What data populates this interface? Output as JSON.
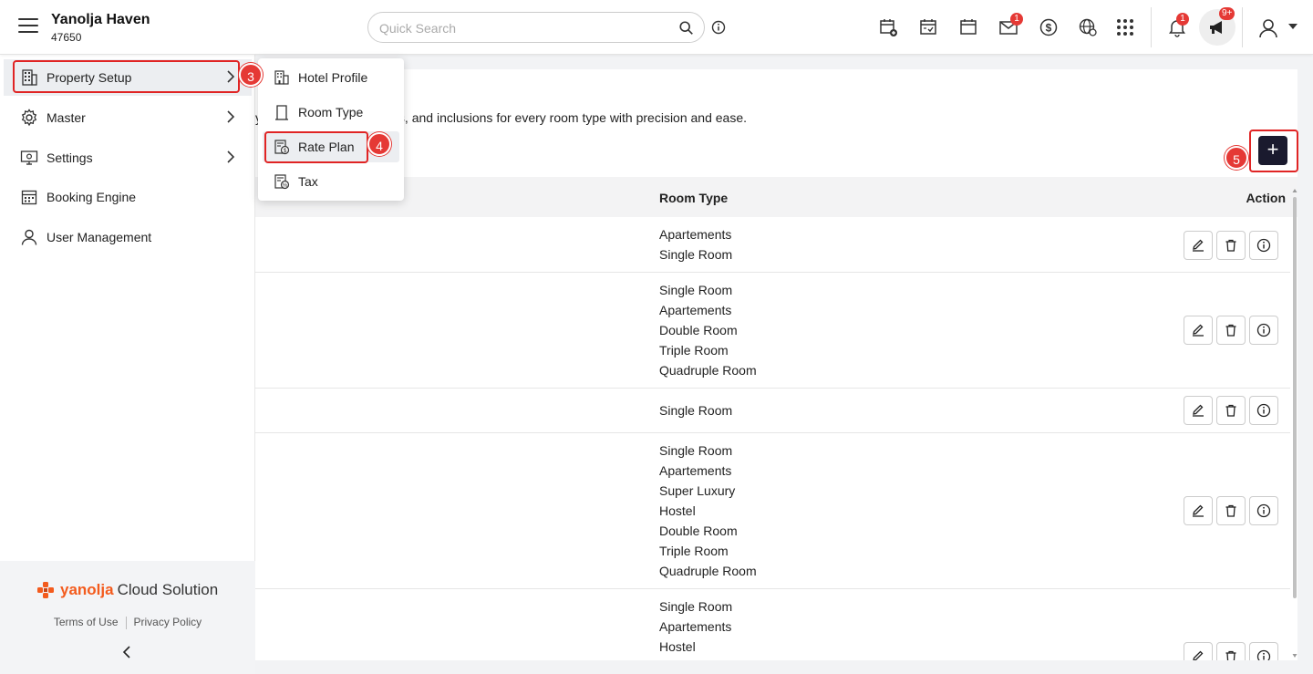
{
  "header": {
    "hotel_name": "Yanolja Haven",
    "hotel_id": "47650",
    "search_placeholder": "Quick Search",
    "mail_badge": "1",
    "notification_badge": "1",
    "announcement_badge": "9+"
  },
  "sidebar": {
    "items": [
      {
        "label": "Property Setup",
        "icon": "building-icon"
      },
      {
        "label": "Master",
        "icon": "gear-icon"
      },
      {
        "label": "Settings",
        "icon": "monitor-settings-icon"
      },
      {
        "label": "Booking Engine",
        "icon": "calendar-grid-icon"
      },
      {
        "label": "User Management",
        "icon": "user-icon"
      }
    ],
    "footer": {
      "brand_name": "yanolja",
      "brand_suffix": "Cloud Solution",
      "terms": "Terms of Use",
      "privacy": "Privacy Policy"
    }
  },
  "submenu": {
    "items": [
      {
        "label": "Hotel Profile",
        "icon": "hotel-icon"
      },
      {
        "label": "Room Type",
        "icon": "door-icon"
      },
      {
        "label": "Rate Plan",
        "icon": "rate-plan-icon"
      },
      {
        "label": "Tax",
        "icon": "tax-icon"
      }
    ]
  },
  "annotations": {
    "m3": "3",
    "m4": "4",
    "m5": "5"
  },
  "main": {
    "description": "y. Manage pricing, policies, and inclusions for every room type with precision and ease.",
    "add_label": "+",
    "columns": {
      "room_type": "Room Type",
      "action": "Action"
    },
    "rows": [
      {
        "rooms": [
          "Apartements",
          "Single Room"
        ]
      },
      {
        "rooms": [
          "Single Room",
          "Apartements",
          "Double Room",
          "Triple Room",
          "Quadruple Room"
        ]
      },
      {
        "rooms": [
          "Single Room"
        ]
      },
      {
        "rooms": [
          "Single Room",
          "Apartements",
          "Super Luxury",
          "Hostel",
          "Double Room",
          "Triple Room",
          "Quadruple Room"
        ]
      },
      {
        "rooms": [
          "Single Room",
          "Apartements",
          "Hostel"
        ]
      }
    ]
  },
  "colors": {
    "accent_red": "#e53935",
    "brand_orange": "#f35b1d",
    "add_button": "#1a1a2e"
  }
}
